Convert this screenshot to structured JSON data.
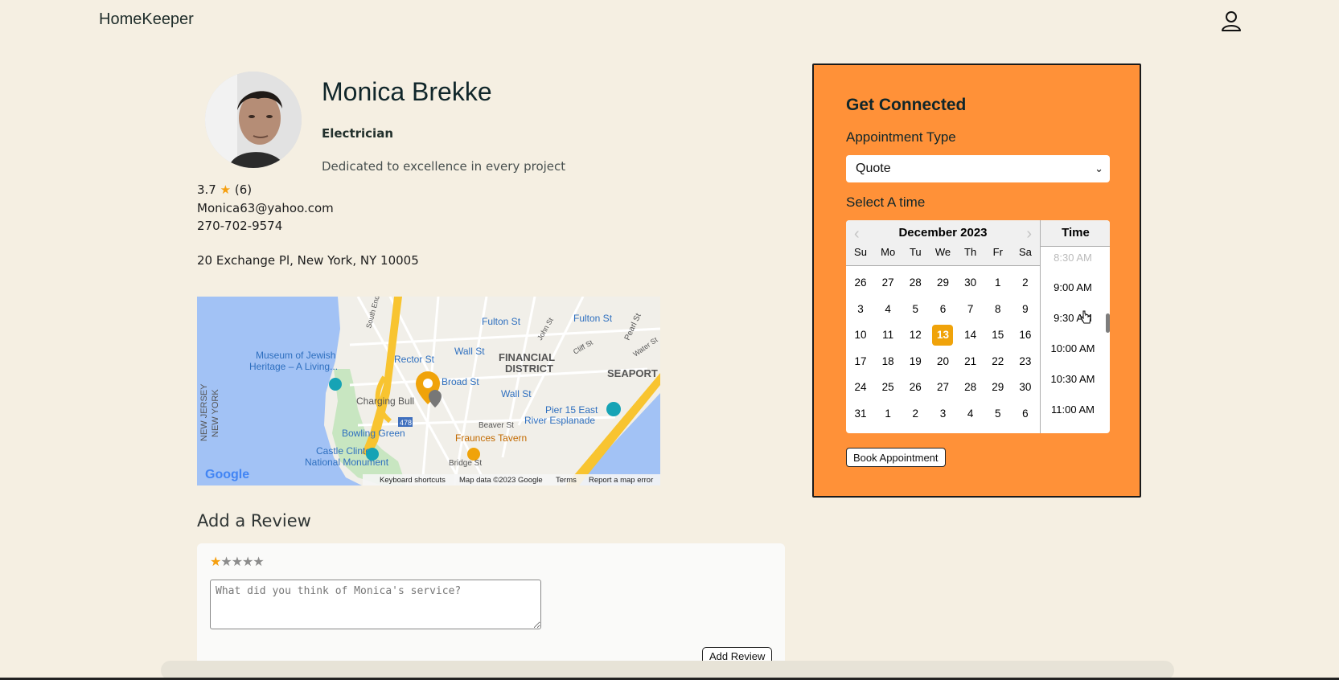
{
  "app": {
    "brand": "HomeKeeper"
  },
  "profile": {
    "name": "Monica Brekke",
    "role": "Electrician",
    "tagline": "Dedicated to excellence in every project",
    "rating": "3.7",
    "rating_star": "★",
    "review_count": "(6)",
    "email": "Monica63@yahoo.com",
    "phone": "270-702-9574",
    "address": "20 Exchange Pl, New York, NY 10005"
  },
  "map": {
    "labels": {
      "fulton1": "Fulton St",
      "fulton2": "Fulton St",
      "pearl": "Pearl St",
      "south_end": "South End",
      "john": "John St",
      "cliff": "Cliff St",
      "water": "Water St",
      "museum1": "Museum of Jewish",
      "museum2": "Heritage – A Living...",
      "rector": "Rector St",
      "wall1": "Wall St",
      "wall2": "Wall St",
      "financial1": "FINANCIAL",
      "financial2": "DISTRICT",
      "seaport": "SEAPORT",
      "nj1": "NEW JERSEY",
      "nj2": "NEW YORK",
      "broad": "Broad St",
      "bull": "Charging Bull",
      "pier1": "Pier 15 East",
      "pier2": "River Esplanade",
      "beaver": "Beaver St",
      "route": "478",
      "bowling": "Bowling Green",
      "fraunces": "Fraunces Tavern",
      "castle1": "Castle Clinton",
      "castle2": "National Monument",
      "bridge": "Bridge St",
      "google": "Google"
    },
    "footer": {
      "shortcuts": "Keyboard shortcuts",
      "mapdata": "Map data ©2023 Google",
      "terms": "Terms",
      "report": "Report a map error"
    }
  },
  "review": {
    "title": "Add a Review",
    "stars_on": "★",
    "stars_off": "★★★★",
    "placeholder": "What did you think of Monica's service?",
    "button": "Add Review"
  },
  "booking": {
    "title": "Get Connected",
    "appointment_label": "Appointment Type",
    "appointment_value": "Quote",
    "select_time_label": "Select A time",
    "calendar": {
      "month": "December 2023",
      "prev": "‹",
      "next": "›",
      "day_names": [
        "Su",
        "Mo",
        "Tu",
        "We",
        "Th",
        "Fr",
        "Sa"
      ],
      "weeks": [
        [
          "26",
          "27",
          "28",
          "29",
          "30",
          "1",
          "2"
        ],
        [
          "3",
          "4",
          "5",
          "6",
          "7",
          "8",
          "9"
        ],
        [
          "10",
          "11",
          "12",
          "13",
          "14",
          "15",
          "16"
        ],
        [
          "17",
          "18",
          "19",
          "20",
          "21",
          "22",
          "23"
        ],
        [
          "24",
          "25",
          "26",
          "27",
          "28",
          "29",
          "30"
        ],
        [
          "31",
          "1",
          "2",
          "3",
          "4",
          "5",
          "6"
        ]
      ],
      "selected": "13"
    },
    "time_header": "Time",
    "times": [
      "8:30 AM",
      "9:00 AM",
      "9:30 AM",
      "10:00 AM",
      "10:30 AM",
      "11:00 AM"
    ],
    "book_button": "Book Appointment"
  },
  "icons": {
    "user": "user-icon",
    "chevron": "chevron-down-icon"
  },
  "colors": {
    "background": "#f5efe2",
    "panel": "#ff9138",
    "accent": "#f0a30a"
  }
}
